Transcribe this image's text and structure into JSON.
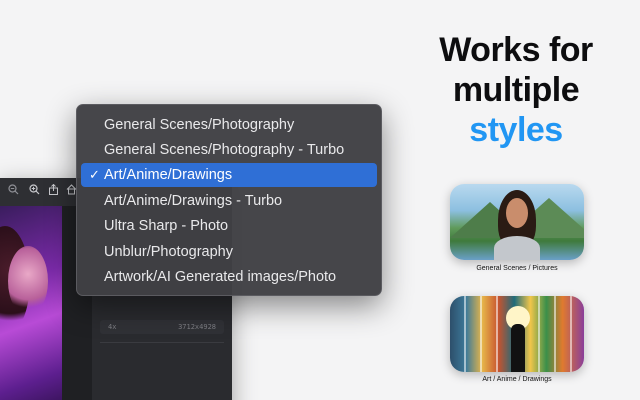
{
  "headline": {
    "line1": "Works for",
    "line2": "multiple",
    "line3": "styles"
  },
  "accent_color": "#2196f3",
  "menu": {
    "items": [
      {
        "label": "General Scenes/Photography",
        "checked": false
      },
      {
        "label": "General Scenes/Photography - Turbo",
        "checked": false
      },
      {
        "label": "Art/Anime/Drawings",
        "checked": true
      },
      {
        "label": "Art/Anime/Drawings - Turbo",
        "checked": false
      },
      {
        "label": "Ultra Sharp - Photo",
        "checked": false
      },
      {
        "label": "Unblur/Photography",
        "checked": false
      },
      {
        "label": "Artwork/AI Generated images/Photo",
        "checked": false
      }
    ],
    "checkmark": "✓",
    "selected_color": "#2f6fd6"
  },
  "app": {
    "toolbar_icons": [
      "zoom-out-icon",
      "zoom-in-icon",
      "share-icon",
      "home-icon"
    ],
    "info_row": {
      "left": "4x",
      "right": "3712x4928"
    }
  },
  "samples": [
    {
      "caption": "General Scenes / Pictures"
    },
    {
      "caption": "Art / Anime / Drawings"
    }
  ]
}
